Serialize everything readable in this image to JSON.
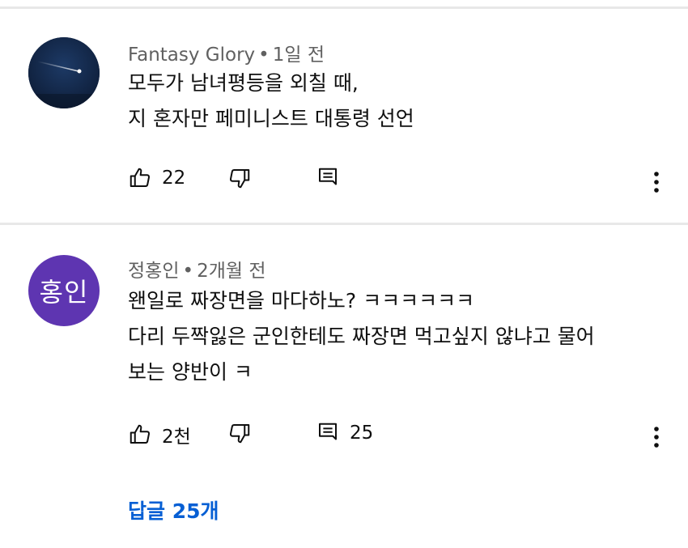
{
  "colors": {
    "link_blue": "#065fd4",
    "divider": "#e8e8e8",
    "avatar2_bg": "#5e35b1",
    "avatar1_bg": "#15284a"
  },
  "comments": [
    {
      "author": "Fantasy Glory",
      "separator": "•",
      "time": "1일 전",
      "lines": [
        "모두가 남녀평등을 외칠 때,",
        "지 혼자만 페미니스트 대통령 선언"
      ],
      "likes": "22",
      "replies_count": "",
      "avatar_icon": "shooting-star-night-sky"
    },
    {
      "author": "정홍인",
      "separator": "•",
      "time": "2개월 전",
      "avatar_text": "홍인",
      "lines": [
        "왠일로 짜장면을 마다하노? ㅋㅋㅋㅋㅋㅋ",
        "다리 두짝잃은 군인한테도 짜장면 먹고싶지 않냐고 물어",
        "보는 양반이 ㅋ"
      ],
      "likes": "2천",
      "replies_count": "25"
    }
  ],
  "view_replies": "답글 25개"
}
